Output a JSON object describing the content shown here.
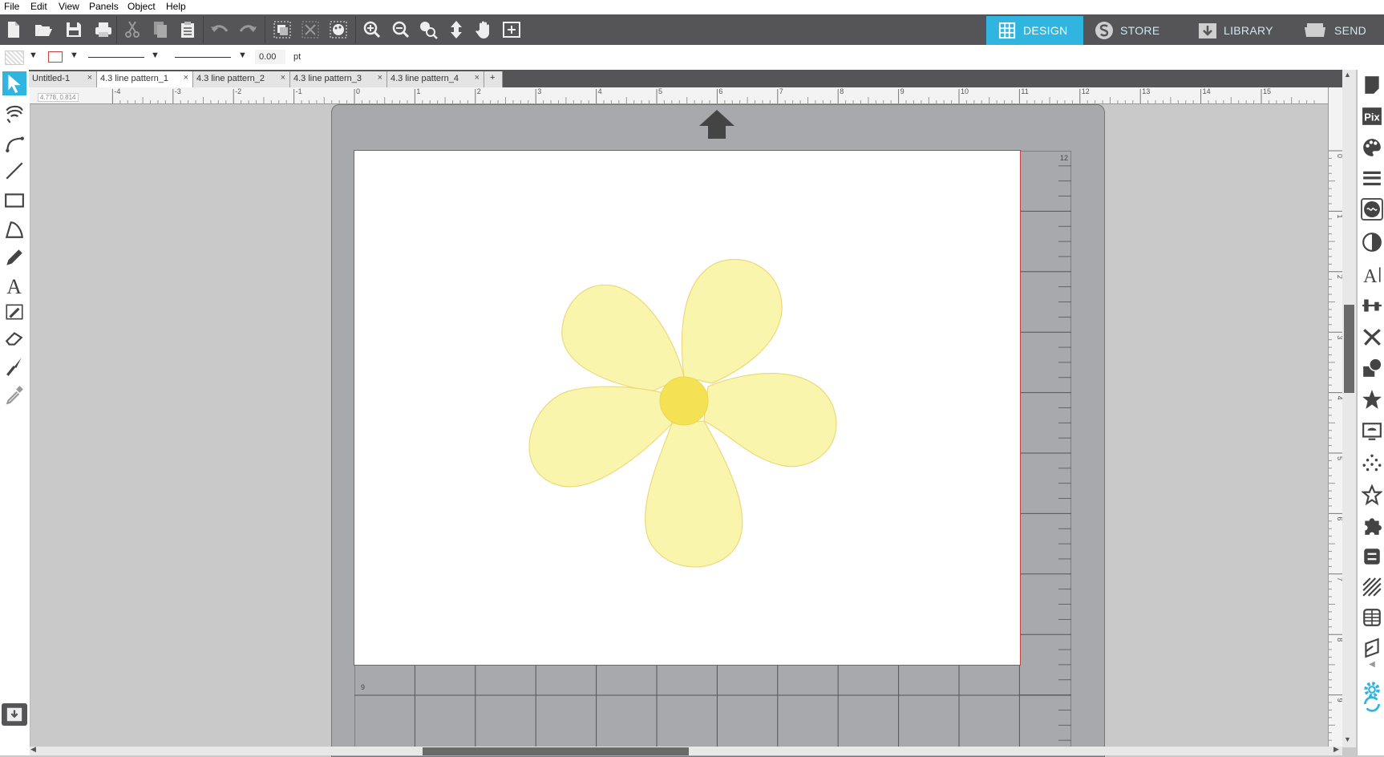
{
  "menu": [
    "File",
    "Edit",
    "View",
    "Panels",
    "Object",
    "Help"
  ],
  "nav_tabs": [
    {
      "label": "DESIGN",
      "icon": "grid-icon",
      "active": true
    },
    {
      "label": "STORE",
      "icon": "store-s-icon",
      "active": false
    },
    {
      "label": "LIBRARY",
      "icon": "library-download-icon",
      "active": false
    },
    {
      "label": "SEND",
      "icon": "cutter-icon",
      "active": false
    }
  ],
  "props": {
    "line_width_value": "0.00",
    "line_width_unit": "pt"
  },
  "doc_tabs": [
    {
      "label": "Untitled-1",
      "active": false
    },
    {
      "label": "4.3 line pattern_1",
      "active": true
    },
    {
      "label": "4.3 line pattern_2",
      "active": false
    },
    {
      "label": "4.3 line pattern_3",
      "active": false
    },
    {
      "label": "4.3 line pattern_4",
      "active": false
    }
  ],
  "add_tab_label": "+",
  "close_glyph": "×",
  "coords": {
    "x": "4.778",
    "y": "0.814"
  },
  "ruler": {
    "h": [
      "-4",
      "-3",
      "-2",
      "-1",
      "0",
      "1",
      "2",
      "3",
      "4",
      "5",
      "6",
      "7",
      "8",
      "9",
      "10",
      "11",
      "12",
      "13",
      "14",
      "15"
    ],
    "v": [
      "0",
      "1",
      "2",
      "3",
      "4",
      "5",
      "6",
      "7",
      "8",
      "9"
    ]
  },
  "mat": {
    "side_label": "12",
    "bottom_label": "9"
  },
  "colors": {
    "accent": "#2fb5e0",
    "toolbar": "#555557",
    "petal_fill": "#faf5ac",
    "petal_stroke": "#ecd97a",
    "center_fill": "#f5e154",
    "mat": "#a8a9ad",
    "page_border": "#c94040"
  }
}
